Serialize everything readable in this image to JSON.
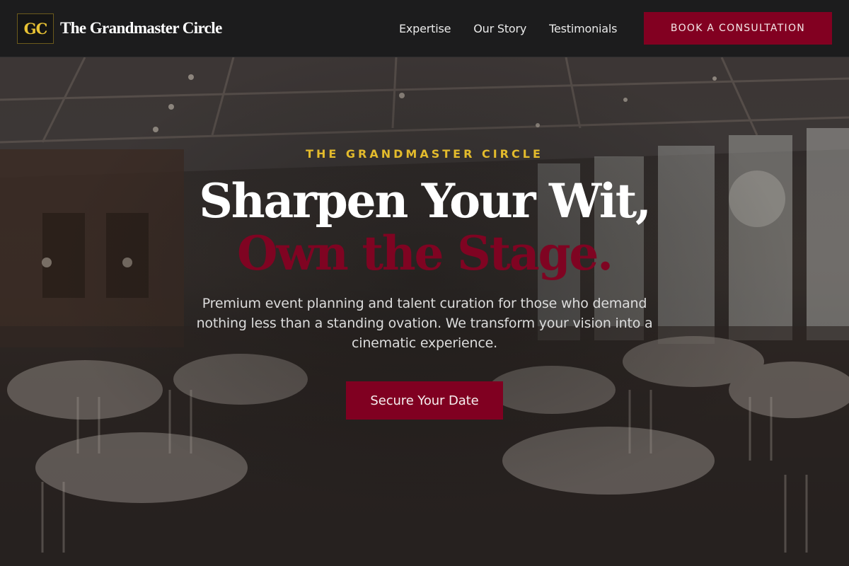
{
  "nav": {
    "logo_mark": "GC",
    "brand_name": "The Grandmaster Circle",
    "links": [
      "Expertise",
      "Our Story",
      "Testimonials"
    ],
    "cta_label": "BOOK A CONSULTATION"
  },
  "hero": {
    "eyebrow": "THE GRANDMASTER CIRCLE",
    "headline_line1": "Sharpen Your Wit,",
    "headline_line2": "Own the Stage.",
    "subtext": "Premium event planning and talent curation for those who demand nothing less than a standing ovation. We transform your vision into a cinematic experience.",
    "cta_label": "Secure Your Date",
    "background_image": "banquet-hall-photo"
  },
  "colors": {
    "accent_crimson": "#820021",
    "accent_gold": "#e3bb2c",
    "nav_background": "#1c1c1d"
  }
}
